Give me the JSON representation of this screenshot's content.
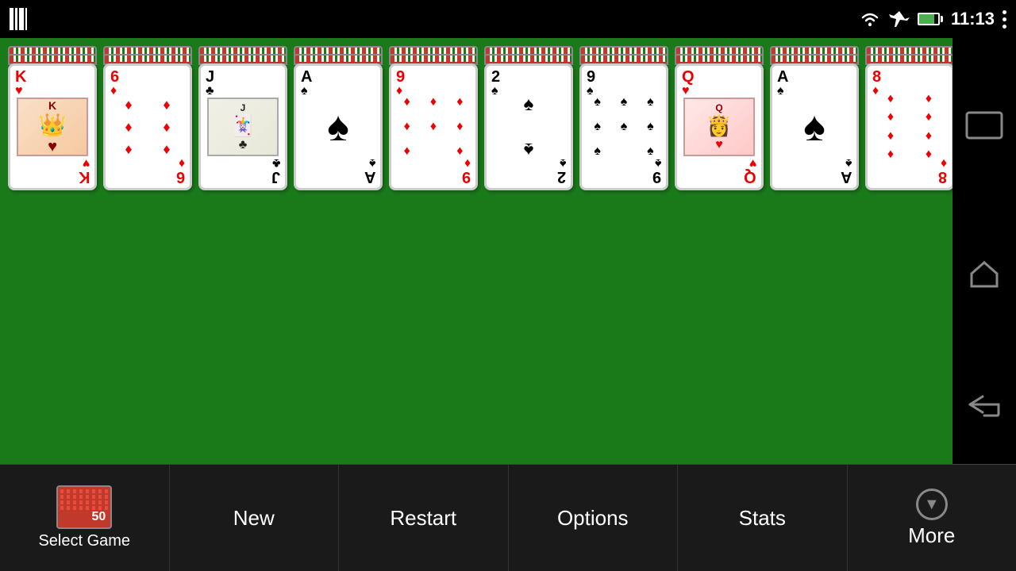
{
  "statusBar": {
    "time": "11:13",
    "wifiIcon": "wifi",
    "planeIcon": "airplane",
    "batteryIcon": "battery"
  },
  "cards": [
    {
      "rank": "K",
      "suit": "♥",
      "color": "red",
      "faceCard": true,
      "faceSymbol": "👑"
    },
    {
      "rank": "6",
      "suit": "♦",
      "color": "red",
      "faceCard": false
    },
    {
      "rank": "J",
      "suit": "♣",
      "color": "black",
      "faceCard": true,
      "faceSymbol": "🃏"
    },
    {
      "rank": "A",
      "suit": "♠",
      "color": "black",
      "faceCard": false,
      "ace": true
    },
    {
      "rank": "9",
      "suit": "♦",
      "color": "red",
      "faceCard": false,
      "pips": 9
    },
    {
      "rank": "2",
      "suit": "♠",
      "color": "black",
      "faceCard": false,
      "pips": 2
    },
    {
      "rank": "9",
      "suit": "♠",
      "color": "black",
      "faceCard": false,
      "pips": 9
    },
    {
      "rank": "Q",
      "suit": "♥",
      "color": "red",
      "faceCard": true,
      "faceSymbol": "👸"
    },
    {
      "rank": "A",
      "suit": "♠",
      "color": "black",
      "faceCard": false,
      "ace": true
    },
    {
      "rank": "8",
      "suit": "♦",
      "color": "red",
      "faceCard": false,
      "pips": 8
    }
  ],
  "bottomNav": {
    "selectGame": "Select Game",
    "gameNumber": "50",
    "newLabel": "New",
    "restartLabel": "Restart",
    "optionsLabel": "Options",
    "statsLabel": "Stats",
    "moreLabel": "More"
  }
}
